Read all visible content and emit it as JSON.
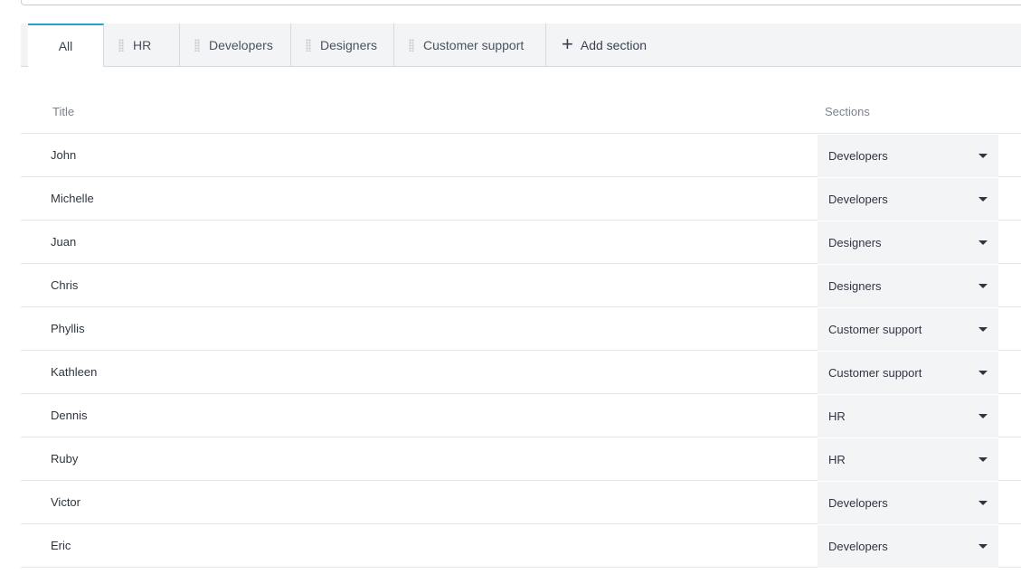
{
  "tabs": {
    "all": "All",
    "items": [
      "HR",
      "Developers",
      "Designers",
      "Customer support"
    ],
    "add_section": "Add section"
  },
  "table": {
    "headers": {
      "title": "Title",
      "sections": "Sections"
    },
    "rows": [
      {
        "title": "John",
        "section": "Developers"
      },
      {
        "title": "Michelle",
        "section": "Developers"
      },
      {
        "title": "Juan",
        "section": "Designers"
      },
      {
        "title": "Chris",
        "section": "Designers"
      },
      {
        "title": "Phyllis",
        "section": "Customer support"
      },
      {
        "title": "Kathleen",
        "section": "Customer support"
      },
      {
        "title": "Dennis",
        "section": "HR"
      },
      {
        "title": "Ruby",
        "section": "HR"
      },
      {
        "title": "Victor",
        "section": "Developers"
      },
      {
        "title": "Eric",
        "section": "Developers"
      }
    ]
  },
  "colors": {
    "accent": "#2aa3c9",
    "tabbar_bg": "#f3f4f6"
  }
}
